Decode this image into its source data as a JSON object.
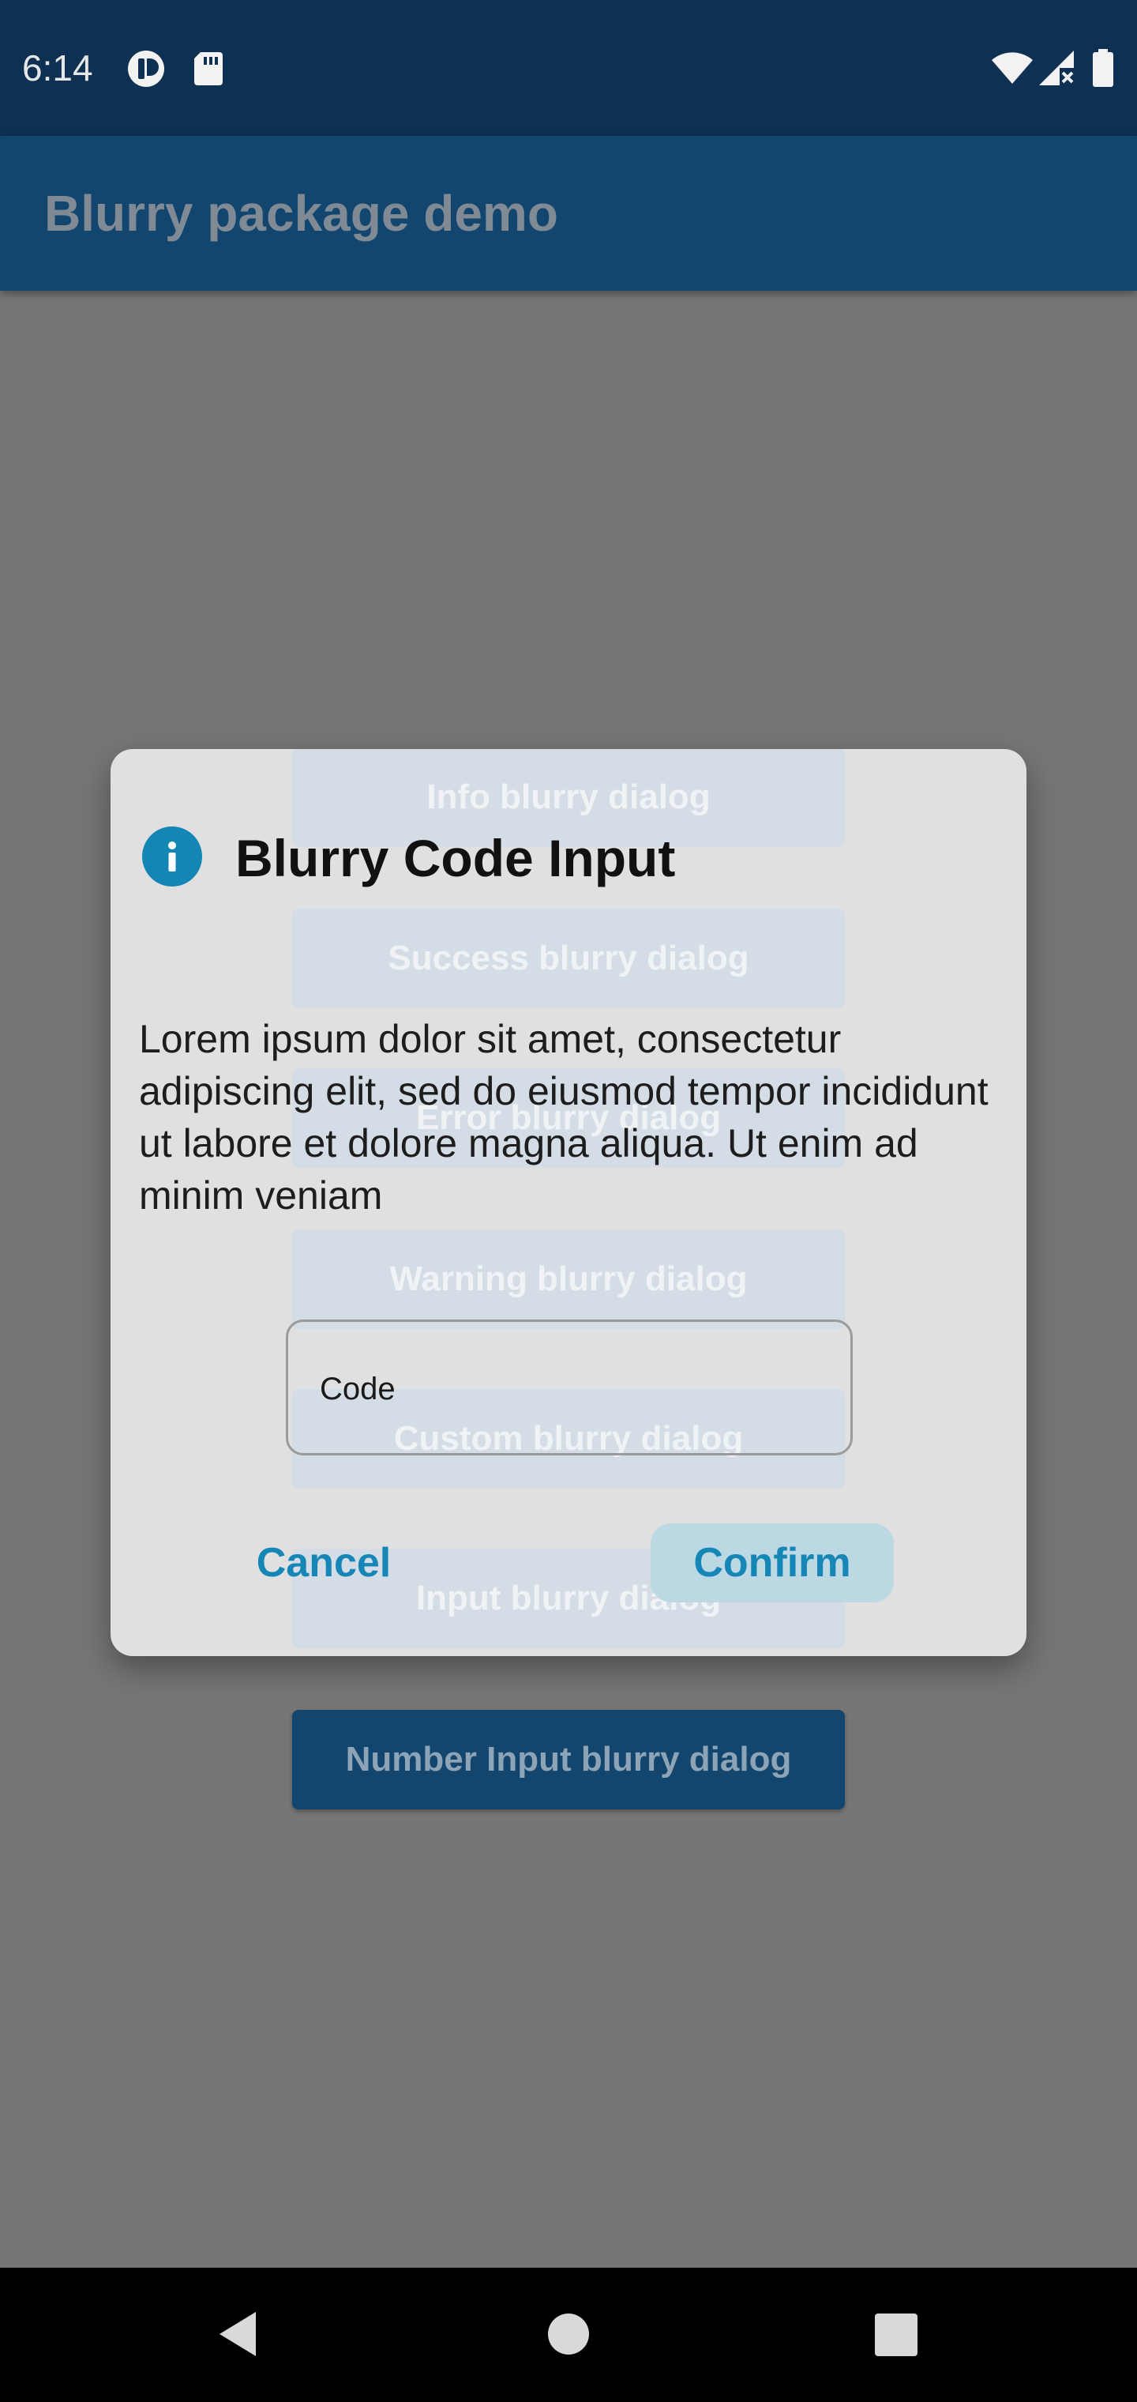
{
  "status_bar": {
    "time": "6:14",
    "icons_left": [
      "tracker-app-icon",
      "sd-card-icon"
    ],
    "icons_right": [
      "wifi-icon",
      "cellular-signal-icon",
      "battery-icon"
    ]
  },
  "app_bar": {
    "title": "Blurry package demo"
  },
  "background_buttons": [
    {
      "label": "Info blurry dialog"
    },
    {
      "label": "Success blurry dialog"
    },
    {
      "label": "Error blurry dialog"
    },
    {
      "label": "Warning blurry dialog"
    },
    {
      "label": "Custom blurry dialog"
    },
    {
      "label": "Input blurry dialog"
    },
    {
      "label": "Number Input blurry dialog"
    }
  ],
  "dialog": {
    "icon": "info-icon",
    "title": "Blurry Code Input",
    "body": "Lorem ipsum dolor sit amet, consectetur adipiscing elit, sed do eiusmod tempor incididunt ut labore et dolore magna aliqua. Ut enim ad minim veniam",
    "input_label": "Code",
    "cancel_label": "Cancel",
    "confirm_label": "Confirm"
  },
  "nav_bar": {
    "icons": [
      "back-icon",
      "home-icon",
      "recents-icon"
    ]
  },
  "colors": {
    "status_bar": "#0e3153",
    "app_bar": "#12466f",
    "accent": "#1586b5",
    "scrim": "#767676"
  }
}
